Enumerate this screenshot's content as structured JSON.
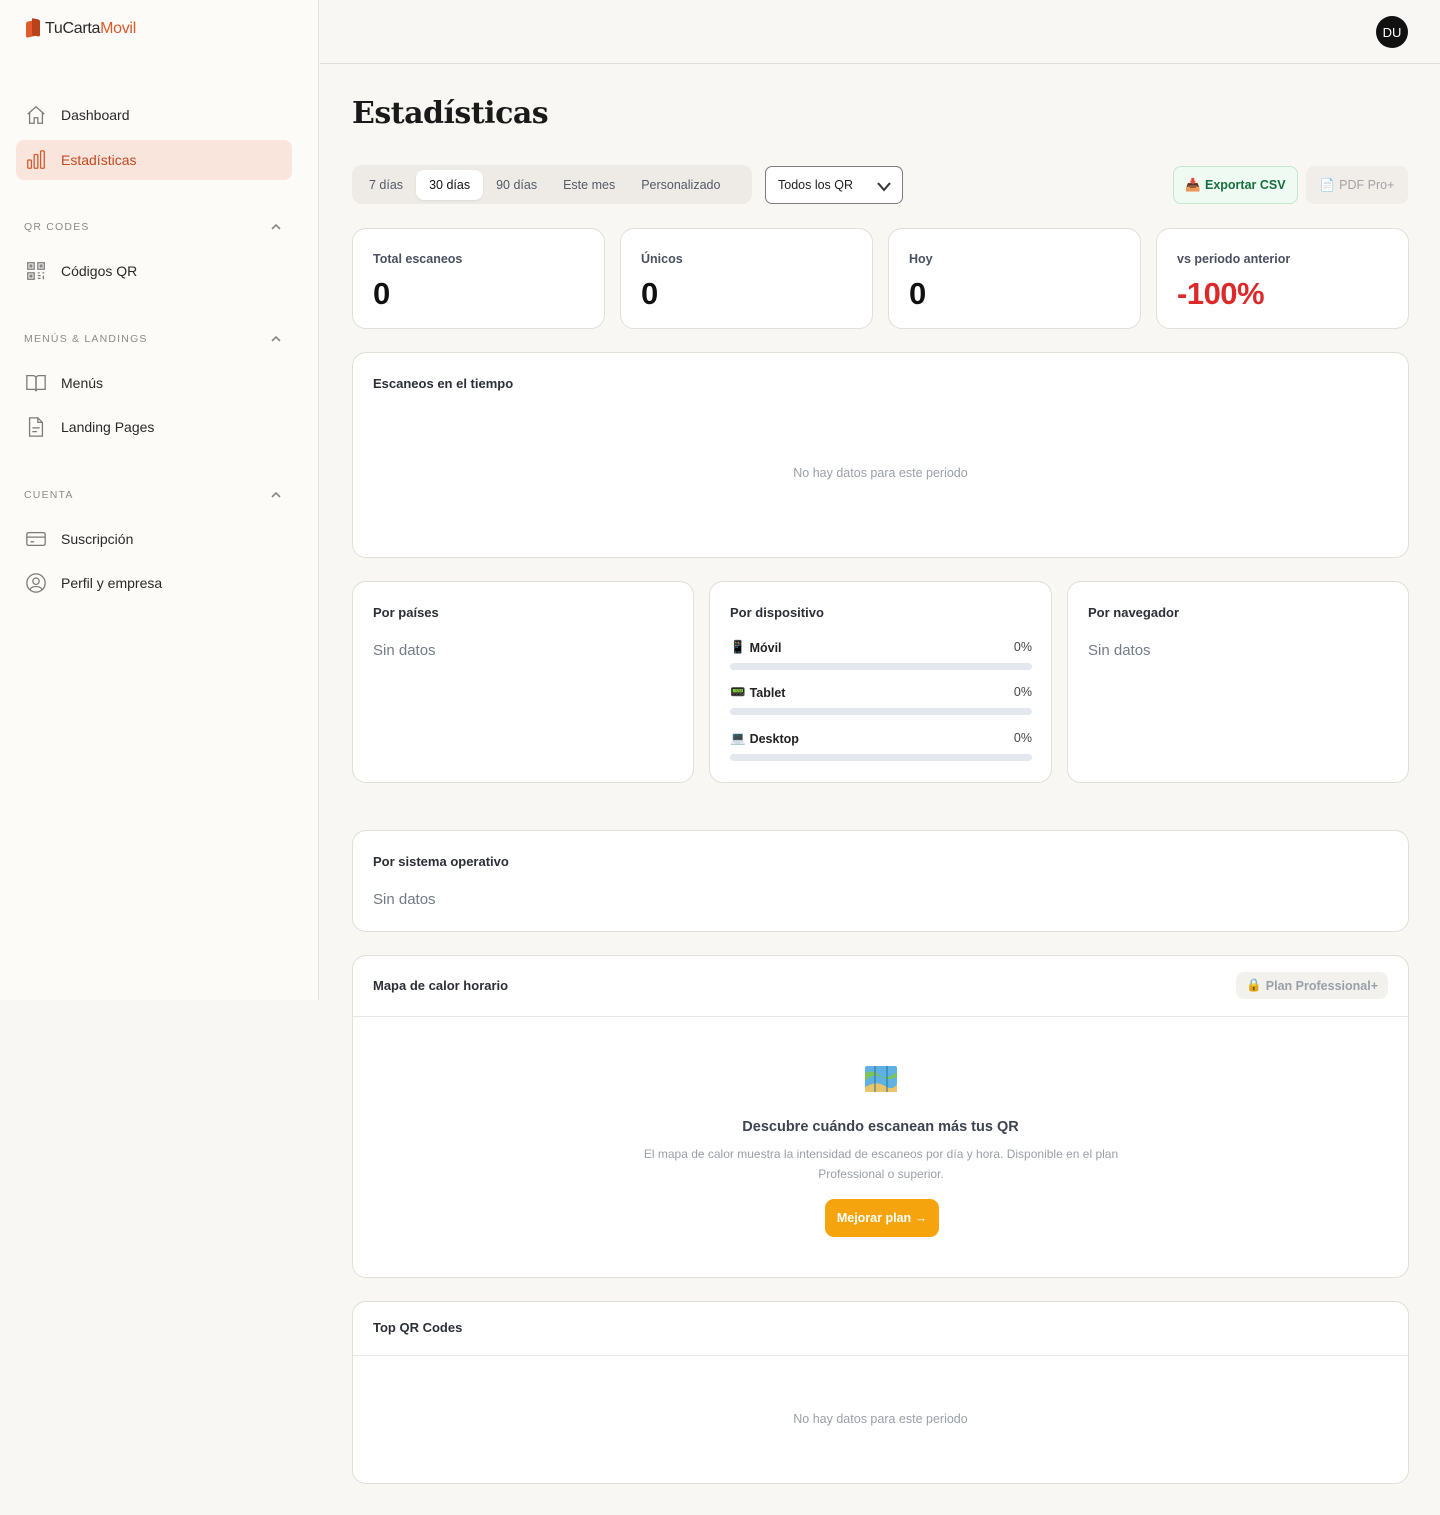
{
  "brand": {
    "name_part1": "TuCarta",
    "name_part2": "Movil",
    "primary_color": "#d8592a"
  },
  "user": {
    "initials": "DU"
  },
  "sidebar": {
    "items_top": [
      {
        "label": "Dashboard",
        "icon": "home-icon"
      },
      {
        "label": "Estadísticas",
        "icon": "bar-chart-icon",
        "active": true
      }
    ],
    "sections": [
      {
        "label": "QR CODES",
        "items": [
          {
            "label": "Códigos QR",
            "icon": "qr-code-icon"
          }
        ]
      },
      {
        "label": "MENÚS & LANDINGS",
        "items": [
          {
            "label": "Menús",
            "icon": "book-open-icon"
          },
          {
            "label": "Landing Pages",
            "icon": "file-icon"
          }
        ]
      },
      {
        "label": "CUENTA",
        "items": [
          {
            "label": "Suscripción",
            "icon": "credit-card-icon"
          },
          {
            "label": "Perfil y empresa",
            "icon": "user-circle-icon"
          }
        ]
      }
    ]
  },
  "page": {
    "title": "Estadísticas"
  },
  "filters": {
    "ranges": [
      "7 días",
      "30 días",
      "90 días",
      "Este mes",
      "Personalizado"
    ],
    "active_range": "30 días",
    "qr_select_value": "Todos los QR",
    "export_csv_label": "Exportar CSV",
    "pdf_label": "PDF  Pro+"
  },
  "stats": [
    {
      "label": "Total escaneos",
      "value": "0"
    },
    {
      "label": "Únicos",
      "value": "0"
    },
    {
      "label": "Hoy",
      "value": "0"
    },
    {
      "label": "vs periodo anterior",
      "value": "-100%"
    }
  ],
  "timeline": {
    "title": "Escaneos en el tiempo",
    "empty": "No hay datos para este periodo"
  },
  "countries": {
    "title": "Por países",
    "empty": "Sin datos"
  },
  "devices": {
    "title": "Por dispositivo",
    "rows": [
      {
        "label": "Móvil",
        "emoji": "📱",
        "percent_label": "0%",
        "percent": 0
      },
      {
        "label": "Tablet",
        "emoji": "📟",
        "percent_label": "0%",
        "percent": 0
      },
      {
        "label": "Desktop",
        "emoji": "💻",
        "percent_label": "0%",
        "percent": 0
      }
    ]
  },
  "browsers": {
    "title": "Por navegador",
    "empty": "Sin datos"
  },
  "os": {
    "title": "Por sistema operativo",
    "empty": "Sin datos"
  },
  "heatmap": {
    "title": "Mapa de calor horario",
    "badge": "Plan Professional+",
    "cta_title": "Descubre cuándo escanean más tus QR",
    "cta_desc": "El mapa de calor muestra la intensidad de escaneos por día y hora. Disponible en el plan Professional o superior.",
    "cta_button": "Mejorar plan →"
  },
  "top_qr": {
    "title": "Top QR Codes",
    "empty": "No hay datos para este periodo"
  }
}
